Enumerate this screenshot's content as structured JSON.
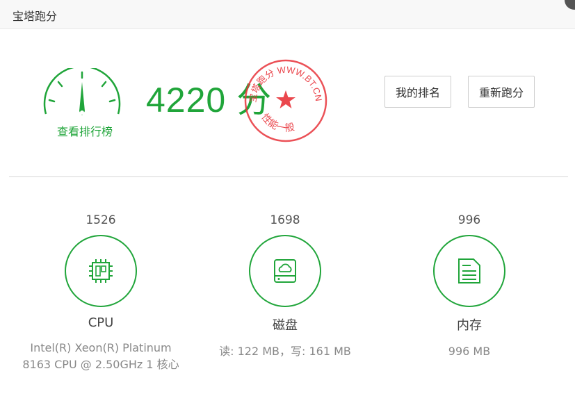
{
  "window": {
    "title": "宝塔跑分"
  },
  "summary": {
    "score_text": "4220 分",
    "rank_link": "查看排行榜",
    "stamp": {
      "top_text": "宝塔跑分 WWW.BT.CN",
      "bottom_text": "性能一般"
    }
  },
  "actions": {
    "my_rank": "我的排名",
    "rerun": "重新跑分"
  },
  "metrics": {
    "cpu": {
      "score": "1526",
      "name": "CPU",
      "detail": "Intel(R) Xeon(R) Platinum 8163 CPU @ 2.50GHz 1 核心"
    },
    "disk": {
      "score": "1698",
      "name": "磁盘",
      "detail": "读: 122 MB，写: 161 MB"
    },
    "mem": {
      "score": "996",
      "name": "内存",
      "detail": "996 MB"
    }
  },
  "colors": {
    "accent": "#20a53a",
    "stamp": "#e8333a"
  },
  "icons": {
    "gauge": "speedometer-icon",
    "cpu": "cpu-chip-icon",
    "disk": "cloud-drive-icon",
    "mem": "memory-doc-icon"
  }
}
